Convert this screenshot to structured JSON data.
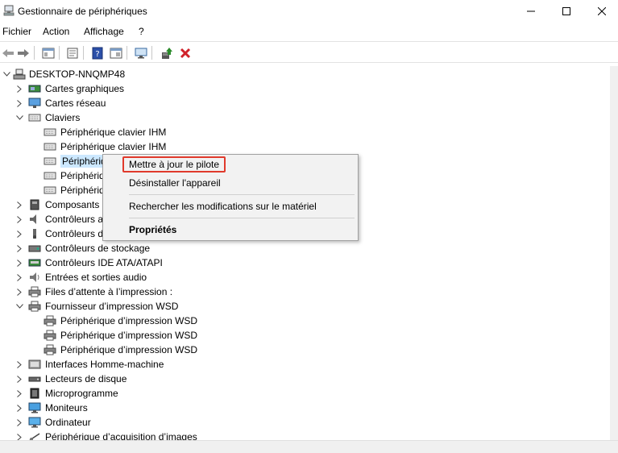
{
  "window": {
    "title": "Gestionnaire de périphériques"
  },
  "menu": [
    "Fichier",
    "Action",
    "Affichage",
    "?"
  ],
  "toolbar": {
    "buttons": [
      "back-icon",
      "forward-icon",
      "console-tree-icon",
      "properties-icon",
      "help-icon",
      "view-icon",
      "monitor-icon",
      "update-driver-icon",
      "uninstall-icon"
    ],
    "uninstall_color": "#d0222a",
    "update_color": "#2a8a2a"
  },
  "tree": {
    "root": "DESKTOP-NNQMP48",
    "items": [
      {
        "label": "Cartes graphiques",
        "expanded": false,
        "icon": "display-adapter-icon"
      },
      {
        "label": "Cartes réseau",
        "expanded": false,
        "icon": "network-adapter-icon"
      },
      {
        "label": "Claviers",
        "expanded": true,
        "icon": "keyboard-icon"
      },
      {
        "label": "Périphérique clavier IHM",
        "child": true,
        "icon": "keyboard-icon"
      },
      {
        "label": "Périphérique clavier IHM",
        "child": true,
        "icon": "keyboard-icon"
      },
      {
        "label": "Périphériq",
        "child": true,
        "icon": "keyboard-icon",
        "selected": true
      },
      {
        "label": "Périphériq",
        "child": true,
        "icon": "keyboard-icon"
      },
      {
        "label": "Périphériq",
        "child": true,
        "icon": "keyboard-icon"
      },
      {
        "label": "Composants",
        "expanded": false,
        "icon": "component-icon"
      },
      {
        "label": "Contrôleurs a",
        "expanded": false,
        "icon": "audio-controller-icon"
      },
      {
        "label": "Contrôleurs d",
        "expanded": false,
        "icon": "usb-controller-icon"
      },
      {
        "label": "Contrôleurs de stockage",
        "expanded": false,
        "icon": "storage-controller-icon"
      },
      {
        "label": "Contrôleurs IDE ATA/ATAPI",
        "expanded": false,
        "icon": "ide-controller-icon"
      },
      {
        "label": "Entrées et sorties audio",
        "expanded": false,
        "icon": "speaker-icon"
      },
      {
        "label": "Files d’attente à l’impression :",
        "expanded": false,
        "icon": "printer-icon"
      },
      {
        "label": "Fournisseur d’impression WSD",
        "expanded": true,
        "icon": "printer-icon"
      },
      {
        "label": "Périphérique d’impression WSD",
        "child": true,
        "icon": "printer-icon"
      },
      {
        "label": "Périphérique d’impression WSD",
        "child": true,
        "icon": "printer-icon"
      },
      {
        "label": "Périphérique d’impression WSD",
        "child": true,
        "icon": "printer-icon"
      },
      {
        "label": "Interfaces Homme-machine",
        "expanded": false,
        "icon": "hid-icon"
      },
      {
        "label": "Lecteurs de disque",
        "expanded": false,
        "icon": "disk-drive-icon"
      },
      {
        "label": "Microprogramme",
        "expanded": false,
        "icon": "firmware-icon"
      },
      {
        "label": "Moniteurs",
        "expanded": false,
        "icon": "monitor-icon"
      },
      {
        "label": "Ordinateur",
        "expanded": false,
        "icon": "computer-icon"
      },
      {
        "label": "Périphérique d’acquisition d’images",
        "expanded": false,
        "icon": "camera-icon"
      }
    ]
  },
  "context_menu": {
    "items": [
      {
        "label": "Mettre à jour le pilote",
        "highlighted": true
      },
      {
        "label": "Désinstaller l'appareil"
      },
      {
        "label": "Rechercher les modifications sur le matériel"
      },
      {
        "label": "Propriétés",
        "bold": true
      }
    ],
    "highlight_color": "#e03a2c"
  }
}
